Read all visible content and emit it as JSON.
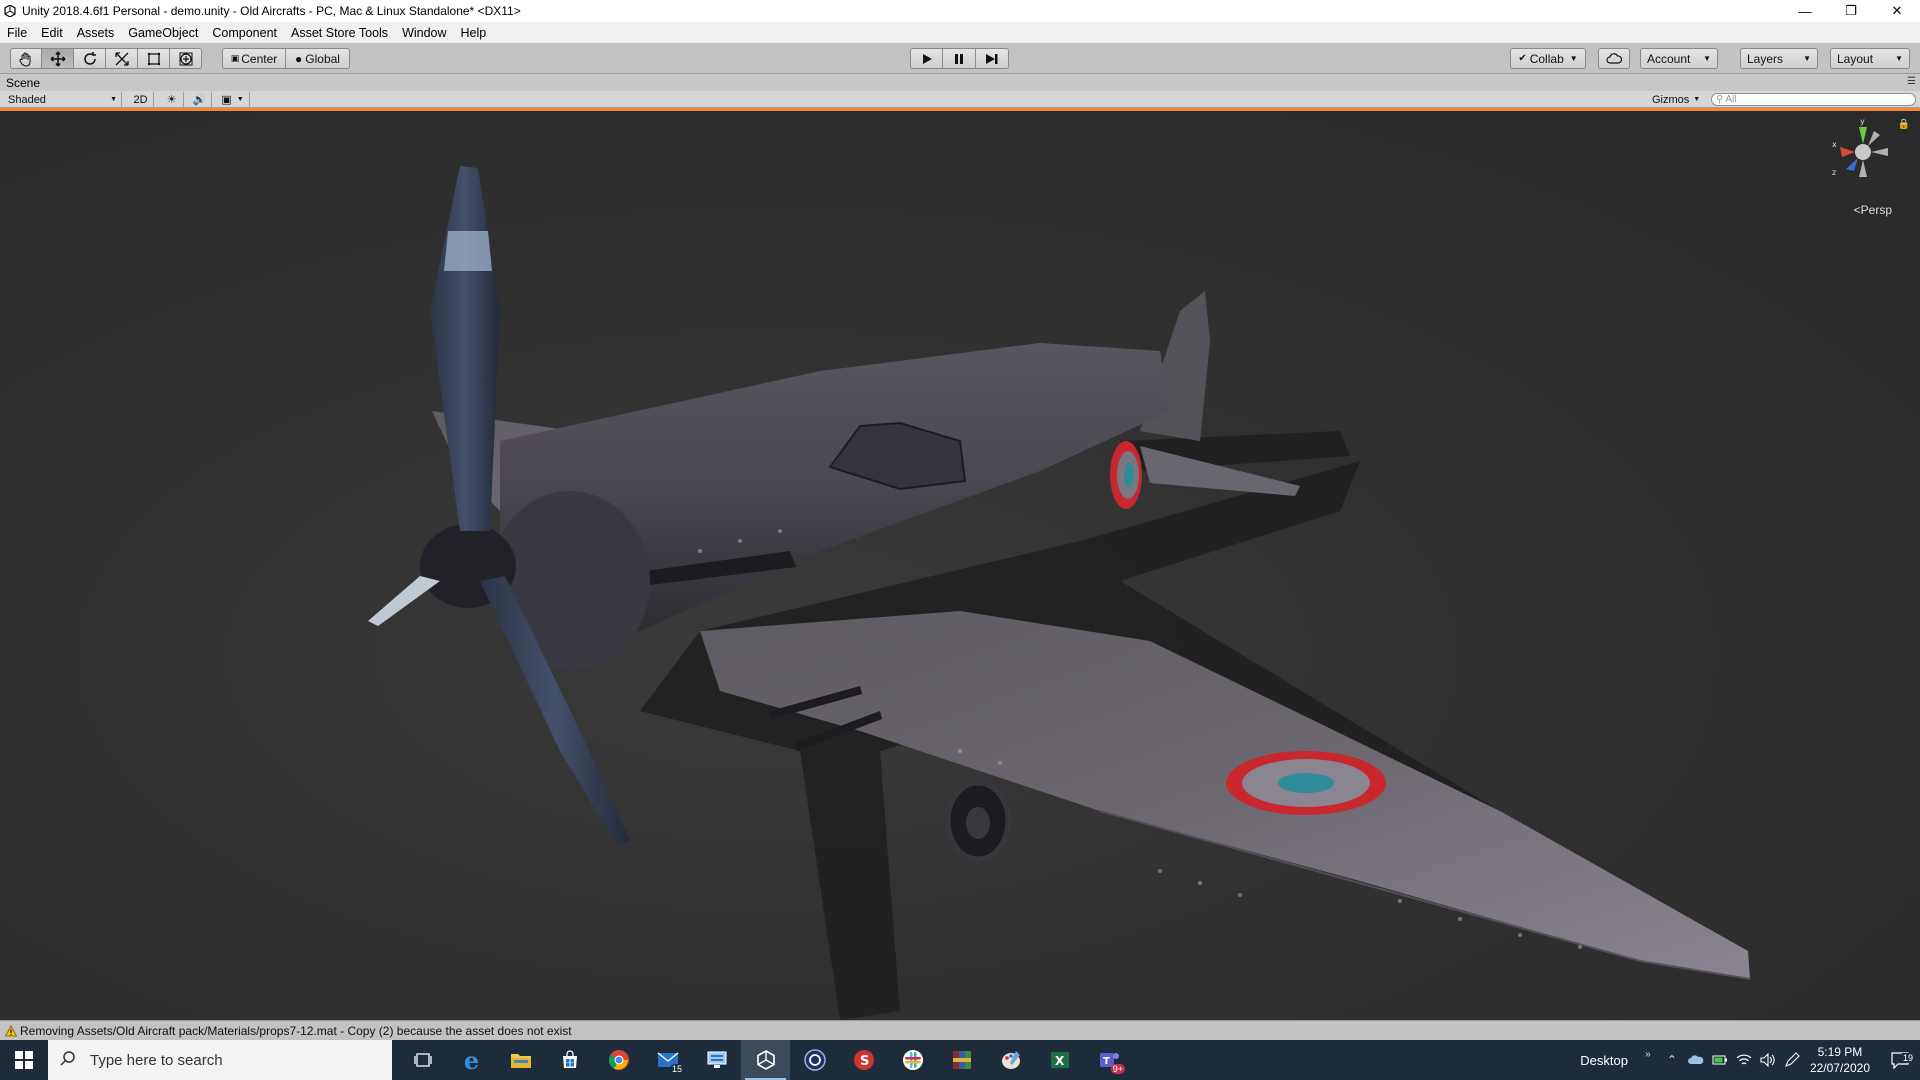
{
  "window": {
    "title": "Unity 2018.4.6f1 Personal - demo.unity - Old Aircrafts - PC, Mac & Linux Standalone* <DX11>",
    "controls": [
      "minimize",
      "restore",
      "close"
    ]
  },
  "menu": [
    "File",
    "Edit",
    "Assets",
    "GameObject",
    "Component",
    "Asset Store Tools",
    "Window",
    "Help"
  ],
  "toolbar": {
    "tools": [
      "hand-tool",
      "move-tool",
      "rotate-tool",
      "scale-tool",
      "rect-tool",
      "transform-tool"
    ],
    "active_tool": "move-tool",
    "pivot_mode": "Center",
    "pivot_rotation": "Global",
    "play_controls": [
      "play",
      "pause",
      "step"
    ],
    "collab": "Collab",
    "account": "Account",
    "layers": "Layers",
    "layout": "Layout"
  },
  "scene": {
    "tab_label": "Scene",
    "draw_mode": "Shaded",
    "mode_2d": "2D",
    "gizmos": "Gizmos",
    "search_placeholder": "All",
    "projection": "Persp",
    "axes": {
      "x": "x",
      "y": "y",
      "z": "z"
    }
  },
  "status": {
    "message": "Removing Assets/Old Aircraft pack/Materials/props7-12.mat - Copy (2) because the asset does not exist"
  },
  "taskbar": {
    "search_placeholder": "Type here to search",
    "apps": [
      {
        "name": "task-view-icon"
      },
      {
        "name": "edge-icon"
      },
      {
        "name": "file-explorer-icon"
      },
      {
        "name": "store-icon"
      },
      {
        "name": "chrome-icon"
      },
      {
        "name": "mail-icon",
        "badge": "15"
      },
      {
        "name": "remote-desktop-icon"
      },
      {
        "name": "unity-icon",
        "active": true
      },
      {
        "name": "cinema4d-icon"
      },
      {
        "name": "substance-icon"
      },
      {
        "name": "slack-icon"
      },
      {
        "name": "winrar-icon"
      },
      {
        "name": "paint-icon"
      },
      {
        "name": "excel-icon"
      },
      {
        "name": "teams-icon",
        "badge": "9+"
      }
    ],
    "desktop_label": "Desktop",
    "time": "5:19 PM",
    "date": "22/07/2020",
    "notifications": "19"
  },
  "colors": {
    "scene_highlight": "#f08a2c",
    "roundel_red": "#c8272d",
    "roundel_blue": "#2f8a9a",
    "taskbar_bg": "#1e2b3b"
  }
}
